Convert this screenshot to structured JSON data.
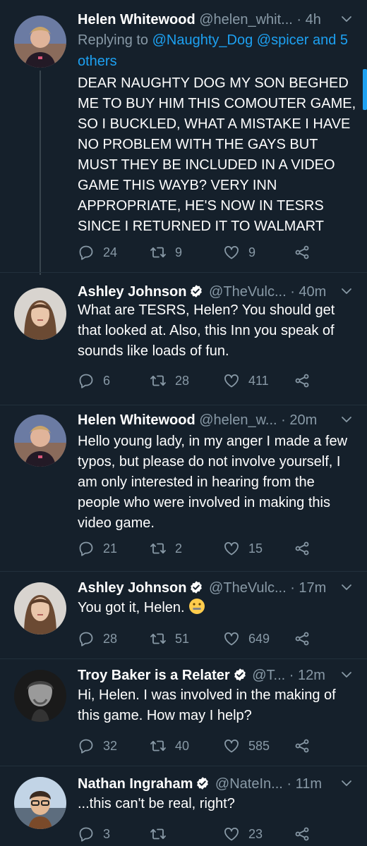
{
  "colors": {
    "background": "#15202b",
    "text": "#ffffff",
    "muted": "#8899a6",
    "accent": "#1da1f2",
    "divider": "#22303c"
  },
  "tweets": [
    {
      "name": "Helen Whitewood",
      "handle": "@helen_whit...",
      "time": "· 4h",
      "reply_prefix": "Replying to ",
      "reply_mentions": "@Naughty_Dog @spicer and 5 others",
      "text": "DEAR NAUGHTY DOG MY SON BEGHED ME TO BUY HIM THIS COMOUTER GAME, SO I BUCKLED, WHAT A MISTAKE I HAVE NO PROBLEM WITH THE GAYS BUT MUST THEY BE INCLUDED IN A VIDEO GAME THIS WAYB? VERY INN APPROPRIATE, HE'S NOW IN TESRS SINCE I RETURNED IT TO WALMART",
      "replies": "24",
      "retweets": "9",
      "likes": "9"
    },
    {
      "name": "Ashley Johnson",
      "handle": "@TheVulc...",
      "time": "· 40m",
      "text": "What are TESRS, Helen? You should get that looked at. Also, this Inn you speak of sounds like loads of fun.",
      "replies": "6",
      "retweets": "28",
      "likes": "411"
    },
    {
      "name": "Helen Whitewood",
      "handle": "@helen_w...",
      "time": "· 20m",
      "text": "Hello young lady, in my anger I made a few typos, but please do not involve yourself, I am only interested in hearing from the people who were involved in making this video game.",
      "replies": "21",
      "retweets": "2",
      "likes": "15"
    },
    {
      "name": "Ashley Johnson",
      "handle": "@TheVulc...",
      "time": "· 17m",
      "text": "You got it, Helen.",
      "emoji": "zipper-mouth-face-icon",
      "replies": "28",
      "retweets": "51",
      "likes": "649"
    },
    {
      "name": "Troy Baker is a Relater",
      "handle": "@T...",
      "time": "· 12m",
      "text": "Hi, Helen. I was involved in the making of this game. How may I help?",
      "replies": "32",
      "retweets": "40",
      "likes": "585"
    },
    {
      "name": "Nathan Ingraham",
      "handle": "@NateIn...",
      "time": "· 11m",
      "text": "...this can't be real, right?",
      "replies": "3",
      "retweets": "",
      "likes": "23"
    }
  ]
}
